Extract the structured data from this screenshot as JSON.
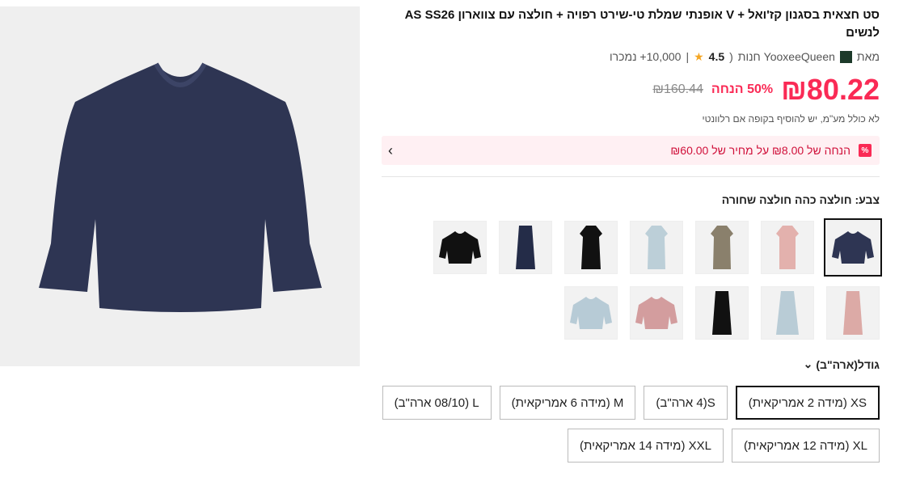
{
  "product": {
    "title": "סט חצאית בסגנון קז'ואל + V אופנתי שמלת טי-שירט רפויה + חולצה עם צווארון AS SS26 לנשים",
    "store_prefix": "מאת",
    "store_name": "YooxeeQueen חנות",
    "rating": "4.5",
    "sold": "10,000+ נמכרו",
    "price": "₪80.22",
    "discount": "50% הנחה",
    "original_price": "₪160.44",
    "tax_note": "לא כולל מע\"מ, יש להוסיף בקופה אם רלוונטי",
    "promo": "הנחה של ₪8.00 על מחיר של ₪60.00",
    "promo_badge": "%"
  },
  "color": {
    "label": "צבע: חולצה כהה חולצה שחורה",
    "options": [
      "navy-shirt",
      "pink-dress",
      "taupe-dress",
      "lightblue-dress",
      "black-dress",
      "navy-skirt",
      "black-shirt",
      "pink-skirt",
      "lightblue-skirt",
      "black-skirt",
      "pink-shirt",
      "lightblue-shirt"
    ]
  },
  "size": {
    "label": "גודל(ארה\"ב)",
    "options": [
      "XS (מידה 2 אמריקאית)",
      "S(4 ארה\"ב)",
      "M (מידה 6 אמריקאית)",
      "L (08/10 ארה\"ב)",
      "XL (מידה 12 אמריקאית)",
      "XXL (מידה 14 אמריקאית)"
    ],
    "selected": "XS (מידה 2 אמריקאית)"
  },
  "colors": {
    "accent": "#fa2a55",
    "navy": "#2e3553",
    "promo_bg": "#fff0f3"
  }
}
